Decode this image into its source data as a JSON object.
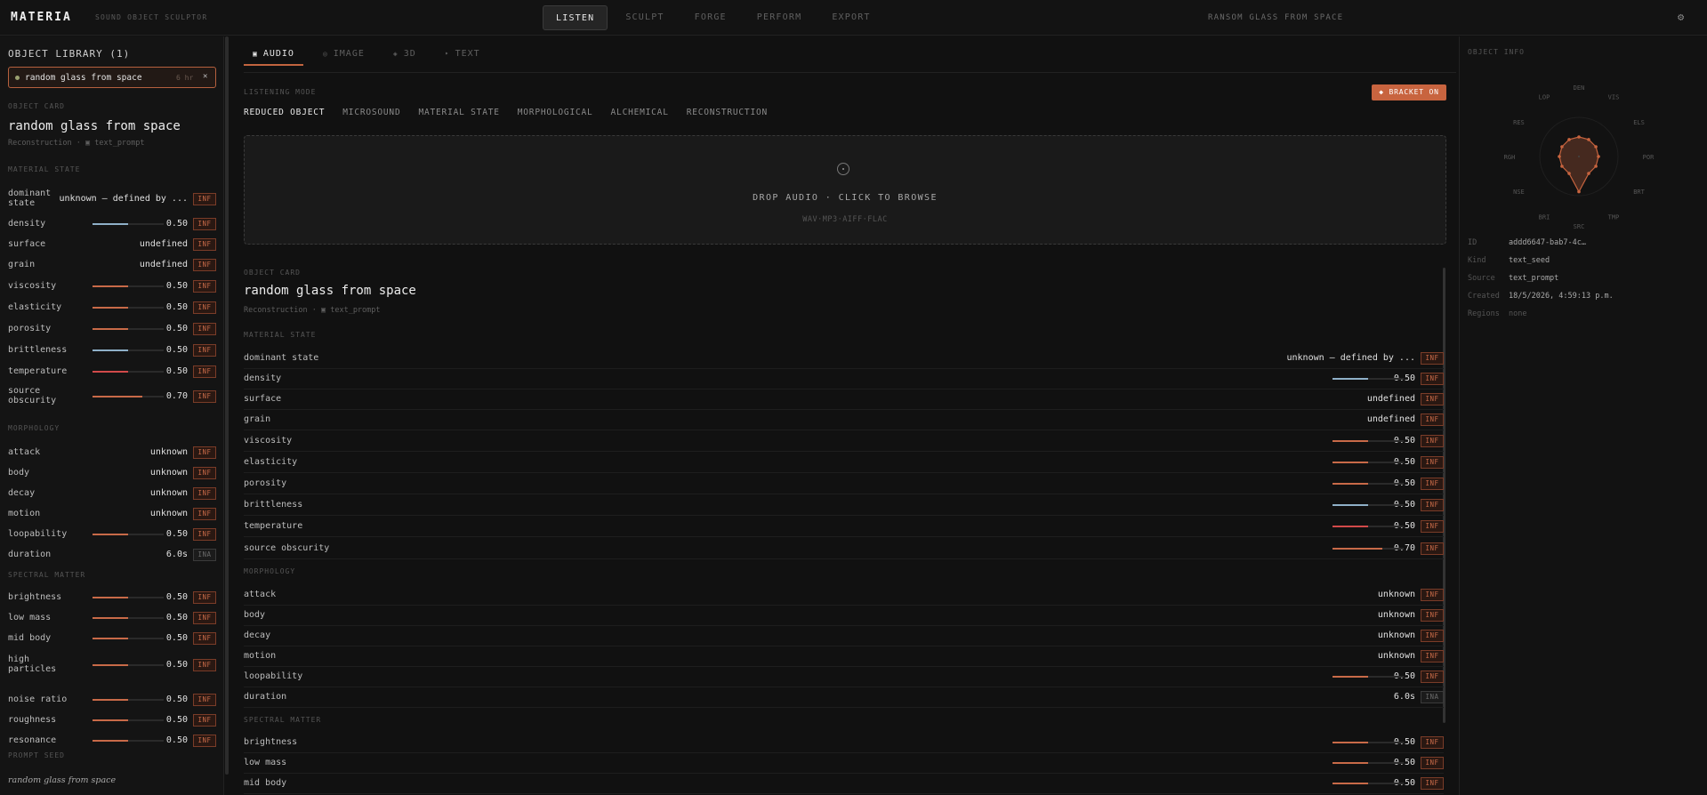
{
  "app": {
    "logo": "MATERIA",
    "subtitle": "SOUND OBJECT SCULPTOR",
    "doc_title": "RANSOM GLASS FROM SPACE",
    "nav": [
      "LISTEN",
      "SCULPT",
      "FORGE",
      "PERFORM",
      "EXPORT"
    ],
    "active_nav": "LISTEN",
    "settings_icon": "gear-icon"
  },
  "library": {
    "title": "OBJECT LIBRARY (1)",
    "items": [
      {
        "name": "random glass from space",
        "duration": "6 hr"
      }
    ]
  },
  "left_card": {
    "header": "OBJECT CARD",
    "title": "random glass from space",
    "subtitle": "Reconstruction · ▣ text_prompt",
    "sections": {
      "material": "MATERIAL STATE",
      "morphology": "MORPHOLOGY",
      "spectral": "SPECTRAL MATTER",
      "seed": "PROMPT SEED"
    },
    "seed_text": "random glass from space"
  },
  "colors": {
    "accent": "#c8643f",
    "bar_warm": "#c86a48",
    "bar_cool": "#8fb0c8",
    "bar_hot": "#d24a4a"
  },
  "material": [
    {
      "label": "dominant state",
      "text": "unknown — defined by ...",
      "tag": "INF"
    },
    {
      "label": "density",
      "value": 0.5,
      "display": "0.50",
      "color": "cool",
      "tag": "INF"
    },
    {
      "label": "surface",
      "text": "undefined",
      "tag": "INF"
    },
    {
      "label": "grain",
      "text": "undefined",
      "tag": "INF"
    },
    {
      "label": "viscosity",
      "value": 0.5,
      "display": "0.50",
      "color": "warm",
      "tag": "INF"
    },
    {
      "label": "elasticity",
      "value": 0.5,
      "display": "0.50",
      "color": "warm",
      "tag": "INF"
    },
    {
      "label": "porosity",
      "value": 0.5,
      "display": "0.50",
      "color": "warm",
      "tag": "INF"
    },
    {
      "label": "brittleness",
      "value": 0.5,
      "display": "0.50",
      "color": "cool",
      "tag": "INF"
    },
    {
      "label": "temperature",
      "value": 0.5,
      "display": "0.50",
      "color": "hot",
      "tag": "INF"
    },
    {
      "label": "source obscurity",
      "value": 0.7,
      "display": "0.70",
      "color": "warm",
      "tag": "INF"
    }
  ],
  "morphology": [
    {
      "label": "attack",
      "text": "unknown",
      "tag": "INF"
    },
    {
      "label": "body",
      "text": "unknown",
      "tag": "INF"
    },
    {
      "label": "decay",
      "text": "unknown",
      "tag": "INF"
    },
    {
      "label": "motion",
      "text": "unknown",
      "tag": "INF"
    },
    {
      "label": "loopability",
      "value": 0.5,
      "display": "0.50",
      "color": "warm",
      "tag": "INF"
    },
    {
      "label": "duration",
      "text": "6.0s",
      "tag": "INA"
    }
  ],
  "spectral": [
    {
      "label": "brightness",
      "value": 0.5,
      "display": "0.50",
      "color": "warm",
      "tag": "INF"
    },
    {
      "label": "low mass",
      "value": 0.5,
      "display": "0.50",
      "color": "warm",
      "tag": "INF"
    },
    {
      "label": "mid body",
      "value": 0.5,
      "display": "0.50",
      "color": "warm",
      "tag": "INF"
    },
    {
      "label": "high particles",
      "value": 0.5,
      "display": "0.50",
      "color": "warm",
      "tag": "INF"
    },
    {
      "label": "noise ratio",
      "value": 0.5,
      "display": "0.50",
      "color": "warm",
      "tag": "INF"
    },
    {
      "label": "roughness",
      "value": 0.5,
      "display": "0.50",
      "color": "warm",
      "tag": "INF"
    },
    {
      "label": "resonance",
      "value": 0.5,
      "display": "0.50",
      "color": "warm",
      "tag": "INF"
    }
  ],
  "center": {
    "tabs": [
      {
        "label": "AUDIO",
        "icon": "▣"
      },
      {
        "label": "IMAGE",
        "icon": "◎"
      },
      {
        "label": "3D",
        "icon": "◈"
      },
      {
        "label": "TEXT",
        "icon": "‣"
      }
    ],
    "listening_label": "LISTENING MODE",
    "bracket_label": "◆ BRACKET ON",
    "modes": [
      "REDUCED OBJECT",
      "MICROSOUND",
      "MATERIAL STATE",
      "MORPHOLOGICAL",
      "ALCHEMICAL",
      "RECONSTRUCTION"
    ],
    "active_mode": "REDUCED OBJECT",
    "drop_text": "DROP AUDIO · CLICK TO BROWSE",
    "drop_formats": "WAV·MP3·AIFF·FLAC",
    "card_header": "OBJECT CARD",
    "card_title": "random glass from space",
    "card_subtitle": "Reconstruction · ▣ text_prompt",
    "material_header": "MATERIAL STATE",
    "morphology_header": "MORPHOLOGY",
    "spectral_header": "SPECTRAL MATTER",
    "spectral_visible": 3
  },
  "info": {
    "title": "OBJECT INFO",
    "radar_labels": [
      "DEN",
      "VIS",
      "ELS",
      "POR",
      "BRT",
      "TMP",
      "SRC",
      "BRI",
      "NSE",
      "RGH",
      "RES",
      "LOP"
    ],
    "radar_values": [
      0.5,
      0.5,
      0.5,
      0.5,
      0.5,
      0.5,
      0.9,
      0.5,
      0.5,
      0.5,
      0.5,
      0.5
    ],
    "rows": [
      {
        "k": "ID",
        "v": "addd6647-bab7-4c…"
      },
      {
        "k": "Kind",
        "v": "text_seed"
      },
      {
        "k": "Source",
        "v": "text_prompt"
      },
      {
        "k": "Created",
        "v": "18/5/2026, 4:59:13 p.m."
      },
      {
        "k": "Regions",
        "v": "none"
      }
    ]
  }
}
